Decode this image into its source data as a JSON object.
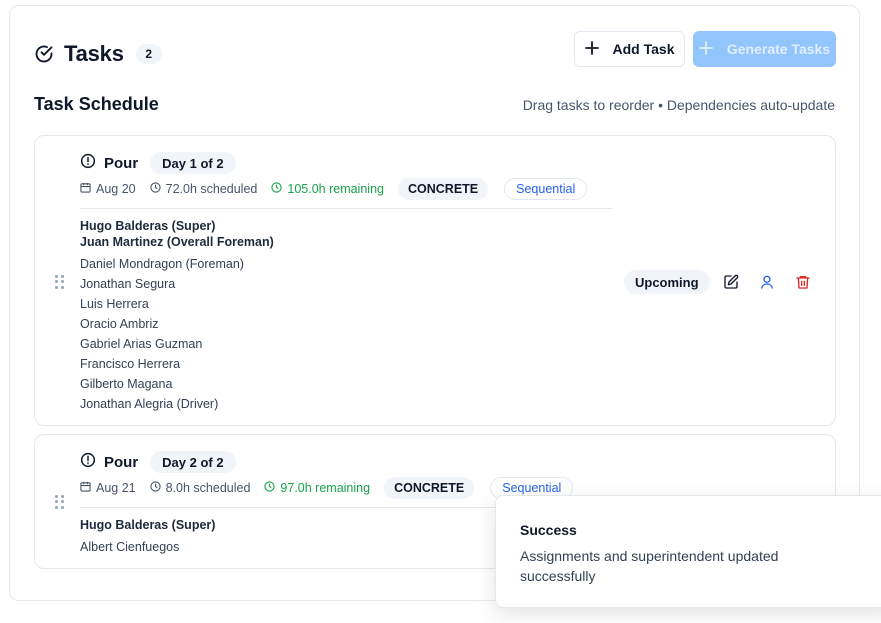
{
  "header": {
    "title": "Tasks",
    "count": "2",
    "add_label": "Add Task",
    "generate_label": "Generate Tasks"
  },
  "section": {
    "title": "Task Schedule",
    "hint": "Drag tasks to reorder • Dependencies auto-update"
  },
  "tasks": [
    {
      "name": "Pour",
      "day": "Day 1 of 2",
      "date": "Aug 20",
      "scheduled": "72.0h scheduled",
      "remaining": "105.0h remaining",
      "category": "CONCRETE",
      "mode": "Sequential",
      "status": "Upcoming",
      "leads": [
        "Hugo Balderas (Super)",
        "Juan Martinez (Overall Foreman)"
      ],
      "members": [
        "Daniel Mondragon (Foreman)",
        "Jonathan Segura",
        "Luis Herrera",
        "Oracio Ambriz",
        "Gabriel Arias Guzman",
        "Francisco Herrera",
        "Gilberto Magana",
        "Jonathan Alegria (Driver)"
      ]
    },
    {
      "name": "Pour",
      "day": "Day 2 of 2",
      "date": "Aug 21",
      "scheduled": "8.0h scheduled",
      "remaining": "97.0h remaining",
      "category": "CONCRETE",
      "mode": "Sequential",
      "leads": [
        "Hugo Balderas (Super)"
      ],
      "members": [
        "Albert Cienfuegos"
      ]
    }
  ],
  "toast": {
    "title": "Success",
    "message": "Assignments and superintendent updated successfully"
  },
  "colors": {
    "accent": "#2563eb",
    "remaining": "#16a34a",
    "delete": "#dc2626",
    "generate_bg": "#93c5fd"
  },
  "icons": [
    "circle-check-icon",
    "plus-icon",
    "alert-circle-icon",
    "calendar-icon",
    "clock-icon",
    "drag-handle-icon",
    "edit-icon",
    "user-icon",
    "trash-icon"
  ]
}
